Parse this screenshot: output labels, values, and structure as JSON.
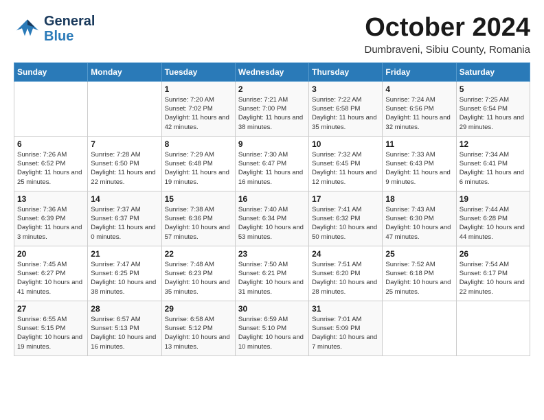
{
  "header": {
    "logo_general": "General",
    "logo_blue": "Blue",
    "month_title": "October 2024",
    "location": "Dumbraveni, Sibiu County, Romania"
  },
  "weekdays": [
    "Sunday",
    "Monday",
    "Tuesday",
    "Wednesday",
    "Thursday",
    "Friday",
    "Saturday"
  ],
  "weeks": [
    [
      {
        "day": "",
        "info": ""
      },
      {
        "day": "",
        "info": ""
      },
      {
        "day": "1",
        "info": "Sunrise: 7:20 AM\nSunset: 7:02 PM\nDaylight: 11 hours and 42 minutes."
      },
      {
        "day": "2",
        "info": "Sunrise: 7:21 AM\nSunset: 7:00 PM\nDaylight: 11 hours and 38 minutes."
      },
      {
        "day": "3",
        "info": "Sunrise: 7:22 AM\nSunset: 6:58 PM\nDaylight: 11 hours and 35 minutes."
      },
      {
        "day": "4",
        "info": "Sunrise: 7:24 AM\nSunset: 6:56 PM\nDaylight: 11 hours and 32 minutes."
      },
      {
        "day": "5",
        "info": "Sunrise: 7:25 AM\nSunset: 6:54 PM\nDaylight: 11 hours and 29 minutes."
      }
    ],
    [
      {
        "day": "6",
        "info": "Sunrise: 7:26 AM\nSunset: 6:52 PM\nDaylight: 11 hours and 25 minutes."
      },
      {
        "day": "7",
        "info": "Sunrise: 7:28 AM\nSunset: 6:50 PM\nDaylight: 11 hours and 22 minutes."
      },
      {
        "day": "8",
        "info": "Sunrise: 7:29 AM\nSunset: 6:48 PM\nDaylight: 11 hours and 19 minutes."
      },
      {
        "day": "9",
        "info": "Sunrise: 7:30 AM\nSunset: 6:47 PM\nDaylight: 11 hours and 16 minutes."
      },
      {
        "day": "10",
        "info": "Sunrise: 7:32 AM\nSunset: 6:45 PM\nDaylight: 11 hours and 12 minutes."
      },
      {
        "day": "11",
        "info": "Sunrise: 7:33 AM\nSunset: 6:43 PM\nDaylight: 11 hours and 9 minutes."
      },
      {
        "day": "12",
        "info": "Sunrise: 7:34 AM\nSunset: 6:41 PM\nDaylight: 11 hours and 6 minutes."
      }
    ],
    [
      {
        "day": "13",
        "info": "Sunrise: 7:36 AM\nSunset: 6:39 PM\nDaylight: 11 hours and 3 minutes."
      },
      {
        "day": "14",
        "info": "Sunrise: 7:37 AM\nSunset: 6:37 PM\nDaylight: 11 hours and 0 minutes."
      },
      {
        "day": "15",
        "info": "Sunrise: 7:38 AM\nSunset: 6:36 PM\nDaylight: 10 hours and 57 minutes."
      },
      {
        "day": "16",
        "info": "Sunrise: 7:40 AM\nSunset: 6:34 PM\nDaylight: 10 hours and 53 minutes."
      },
      {
        "day": "17",
        "info": "Sunrise: 7:41 AM\nSunset: 6:32 PM\nDaylight: 10 hours and 50 minutes."
      },
      {
        "day": "18",
        "info": "Sunrise: 7:43 AM\nSunset: 6:30 PM\nDaylight: 10 hours and 47 minutes."
      },
      {
        "day": "19",
        "info": "Sunrise: 7:44 AM\nSunset: 6:28 PM\nDaylight: 10 hours and 44 minutes."
      }
    ],
    [
      {
        "day": "20",
        "info": "Sunrise: 7:45 AM\nSunset: 6:27 PM\nDaylight: 10 hours and 41 minutes."
      },
      {
        "day": "21",
        "info": "Sunrise: 7:47 AM\nSunset: 6:25 PM\nDaylight: 10 hours and 38 minutes."
      },
      {
        "day": "22",
        "info": "Sunrise: 7:48 AM\nSunset: 6:23 PM\nDaylight: 10 hours and 35 minutes."
      },
      {
        "day": "23",
        "info": "Sunrise: 7:50 AM\nSunset: 6:21 PM\nDaylight: 10 hours and 31 minutes."
      },
      {
        "day": "24",
        "info": "Sunrise: 7:51 AM\nSunset: 6:20 PM\nDaylight: 10 hours and 28 minutes."
      },
      {
        "day": "25",
        "info": "Sunrise: 7:52 AM\nSunset: 6:18 PM\nDaylight: 10 hours and 25 minutes."
      },
      {
        "day": "26",
        "info": "Sunrise: 7:54 AM\nSunset: 6:17 PM\nDaylight: 10 hours and 22 minutes."
      }
    ],
    [
      {
        "day": "27",
        "info": "Sunrise: 6:55 AM\nSunset: 5:15 PM\nDaylight: 10 hours and 19 minutes."
      },
      {
        "day": "28",
        "info": "Sunrise: 6:57 AM\nSunset: 5:13 PM\nDaylight: 10 hours and 16 minutes."
      },
      {
        "day": "29",
        "info": "Sunrise: 6:58 AM\nSunset: 5:12 PM\nDaylight: 10 hours and 13 minutes."
      },
      {
        "day": "30",
        "info": "Sunrise: 6:59 AM\nSunset: 5:10 PM\nDaylight: 10 hours and 10 minutes."
      },
      {
        "day": "31",
        "info": "Sunrise: 7:01 AM\nSunset: 5:09 PM\nDaylight: 10 hours and 7 minutes."
      },
      {
        "day": "",
        "info": ""
      },
      {
        "day": "",
        "info": ""
      }
    ]
  ]
}
